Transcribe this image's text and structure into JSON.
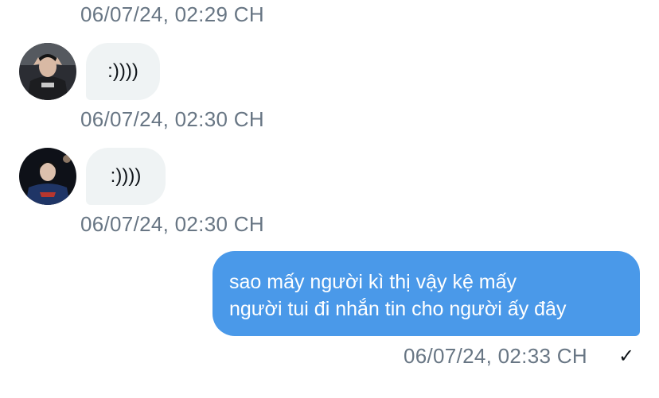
{
  "messages": [
    {
      "timestamp": "06/07/24, 02:29 CH"
    },
    {
      "avatar": "user-avatar-1",
      "text": ":))))",
      "timestamp": "06/07/24, 02:30 CH"
    },
    {
      "avatar": "user-avatar-2",
      "text": ":))))",
      "timestamp": "06/07/24, 02:30 CH"
    },
    {
      "outgoing": true,
      "lines": [
        "sao mấy người kì thị vậy kệ mấy",
        "người tui đi nhắn tin cho người ấy đây"
      ],
      "timestamp": "06/07/24, 02:33 CH",
      "status_icon": "checkmark-icon",
      "status_glyph": "✓"
    }
  ],
  "colors": {
    "outgoing_bubble": "#4a99e9",
    "incoming_bubble": "#eff3f4",
    "timestamp": "#687684"
  }
}
